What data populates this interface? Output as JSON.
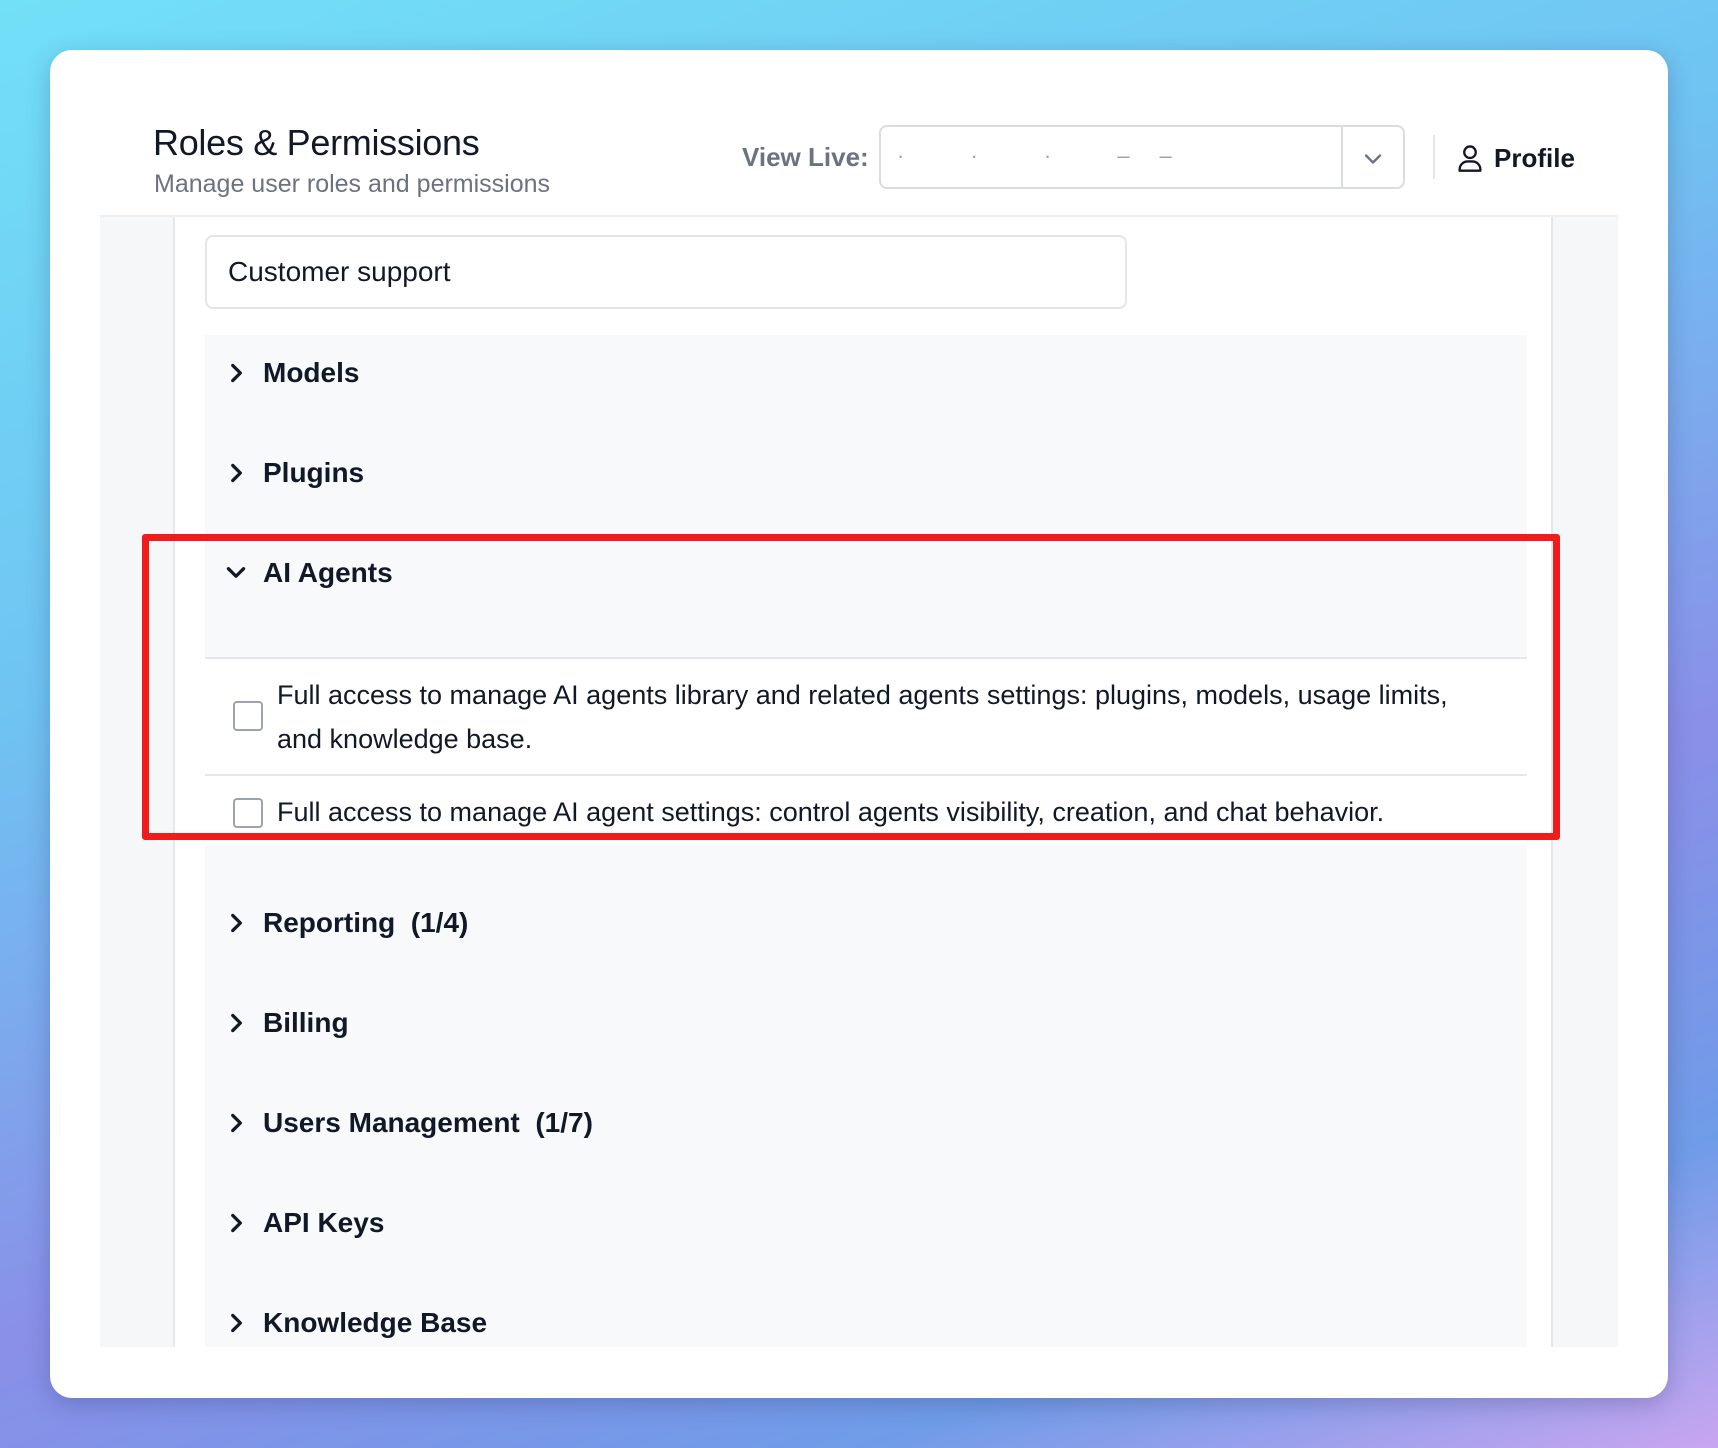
{
  "header": {
    "title": "Roles & Permissions",
    "subtitle": "Manage user roles and permissions",
    "view_live_label": "View Live:",
    "view_live_value": "· · · ––",
    "profile_label": "Profile"
  },
  "role": {
    "name_value": "Customer support"
  },
  "sections": [
    {
      "label": "Models",
      "expanded": false,
      "icon": "chevron-right-icon"
    },
    {
      "label": "Plugins",
      "expanded": false,
      "icon": "chevron-right-icon"
    },
    {
      "label": "AI Agents",
      "expanded": true,
      "icon": "chevron-down-icon",
      "permissions": [
        {
          "text": "Full access to manage AI agents library and related agents settings: plugins, models, usage limits, and knowledge base.",
          "checked": false
        },
        {
          "text": "Full access to manage AI agent settings: control agents visibility, creation, and chat behavior.",
          "checked": false
        }
      ]
    },
    {
      "label": "Reporting  (1/4)",
      "expanded": false,
      "icon": "chevron-right-icon"
    },
    {
      "label": "Billing",
      "expanded": false,
      "icon": "chevron-right-icon"
    },
    {
      "label": "Users Management  (1/7)",
      "expanded": false,
      "icon": "chevron-right-icon"
    },
    {
      "label": "API Keys",
      "expanded": false,
      "icon": "chevron-right-icon"
    },
    {
      "label": "Knowledge Base",
      "expanded": false,
      "icon": "chevron-right-icon"
    }
  ],
  "colors": {
    "highlight": "#f01b1b",
    "text": "#111827",
    "muted": "#6b7280"
  }
}
